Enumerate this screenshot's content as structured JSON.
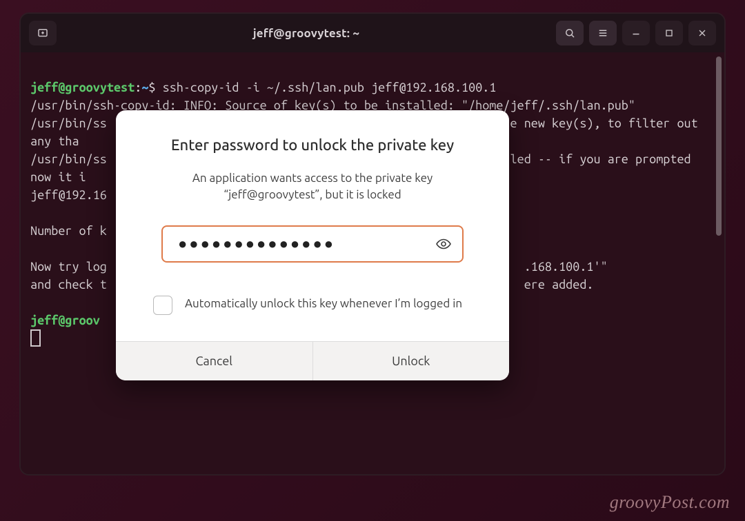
{
  "titlebar": {
    "title": "jeff@groovytest: ~"
  },
  "terminal": {
    "prompt": {
      "user": "jeff",
      "host": "groovytest",
      "path_symbol": "~",
      "sep": "@",
      "colon": ":",
      "dollar": "$"
    },
    "command": "ssh-copy-id -i ~/.ssh/lan.pub jeff@192.168.100.1",
    "lines": {
      "l1": "/usr/bin/ssh-copy-id: INFO: Source of key(s) to be installed: \"/home/jeff/.ssh/lan.pub\"",
      "l2a": "/usr/bin/ss",
      "l2b": "e new key(s), to filter out any tha",
      "l3a": "/usr/bin/ss",
      "l3b": "led -- if you are prompted now it i",
      "l4a": "jeff@192.16",
      "l5a": "Number of k",
      "l6a": "Now try log",
      "l6b": ".168.100.1'\"",
      "l7a": "and check t",
      "l7b": "ere added."
    },
    "prompt2": {
      "user": "jeff",
      "host_partial": "groov"
    }
  },
  "modal": {
    "title": "Enter password to unlock the private key",
    "message": "An application wants access to the private key “jeff@groovytest”, but it is locked",
    "password_mask": "●●●●●●●●●●●●●●",
    "auto_unlock_label": "Automatically unlock this key whenever I’m logged in",
    "cancel": "Cancel",
    "unlock": "Unlock"
  },
  "watermark": "groovyPost.com"
}
